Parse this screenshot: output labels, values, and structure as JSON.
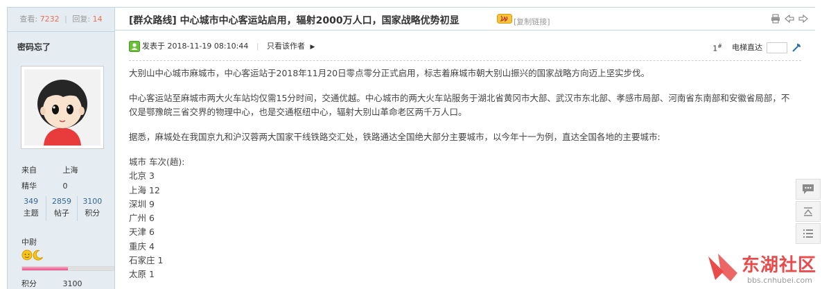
{
  "sidebar": {
    "views_label": "查看:",
    "views": "7232",
    "replies_label": "回复:",
    "replies": "14",
    "username": "密码忘了",
    "from_label": "来自",
    "from_value": "上海",
    "essence_label": "精华",
    "essence_value": "0",
    "counts": [
      {
        "n": "349",
        "label": "主题"
      },
      {
        "n": "2859",
        "label": "帖子"
      },
      {
        "n": "3100",
        "label": "积分"
      }
    ],
    "rank": "中尉",
    "level_progress": 0.5,
    "points_label": "积分",
    "points_value": "3100"
  },
  "thread": {
    "title": "[群众路线] 中心城市中心客运站启用，辐射2000万人口，国家战略优势初显",
    "copy_link": "[复制链接]"
  },
  "post_meta": {
    "posted_prefix": "发表于",
    "datetime": "2018-11-19 08:10:44",
    "author_only": "只看该作者",
    "floor": "1",
    "floor_sup": "#",
    "jump_label": "电梯直达"
  },
  "body": {
    "p1": "大别山中心城市麻城市，中心客运站于2018年11月20日零点零分正式启用，标志着麻城市朝大别山振兴的国家战略方向迈上坚实步伐。",
    "p2": "中心客运站至麻城市两大火车站均仅需15分时间，交通优越。中心城市的两大火车站服务于湖北省黄冈市大部、武汉市东北部、孝感市局部、河南省东南部和安徽省局部，不仅是鄂豫皖三省交界的物理中心，也是交通枢纽中心，辐射大别山革命老区两千万人口。",
    "p3": "据悉，麻城处在我国京九和沪汉蓉两大国家干线铁路交汇处，铁路通达全国绝大部分主要城市，以今年十一为例，直达全国各地的主要城市:",
    "list_header": "城市 车次(趟):",
    "cities": [
      "北京 3",
      "上海 12",
      "深圳 9",
      "广州 6",
      "天津 6",
      "重庆 4",
      "石家庄 1",
      "太原 1"
    ]
  },
  "watermark": {
    "name": "东湖社区",
    "url": "bbs.cnhubei.com"
  },
  "colors": {
    "accent_red": "#e94b4b",
    "link_blue": "#336699",
    "sidebar_bg": "#e5edf2",
    "border": "#c2d5e3"
  }
}
